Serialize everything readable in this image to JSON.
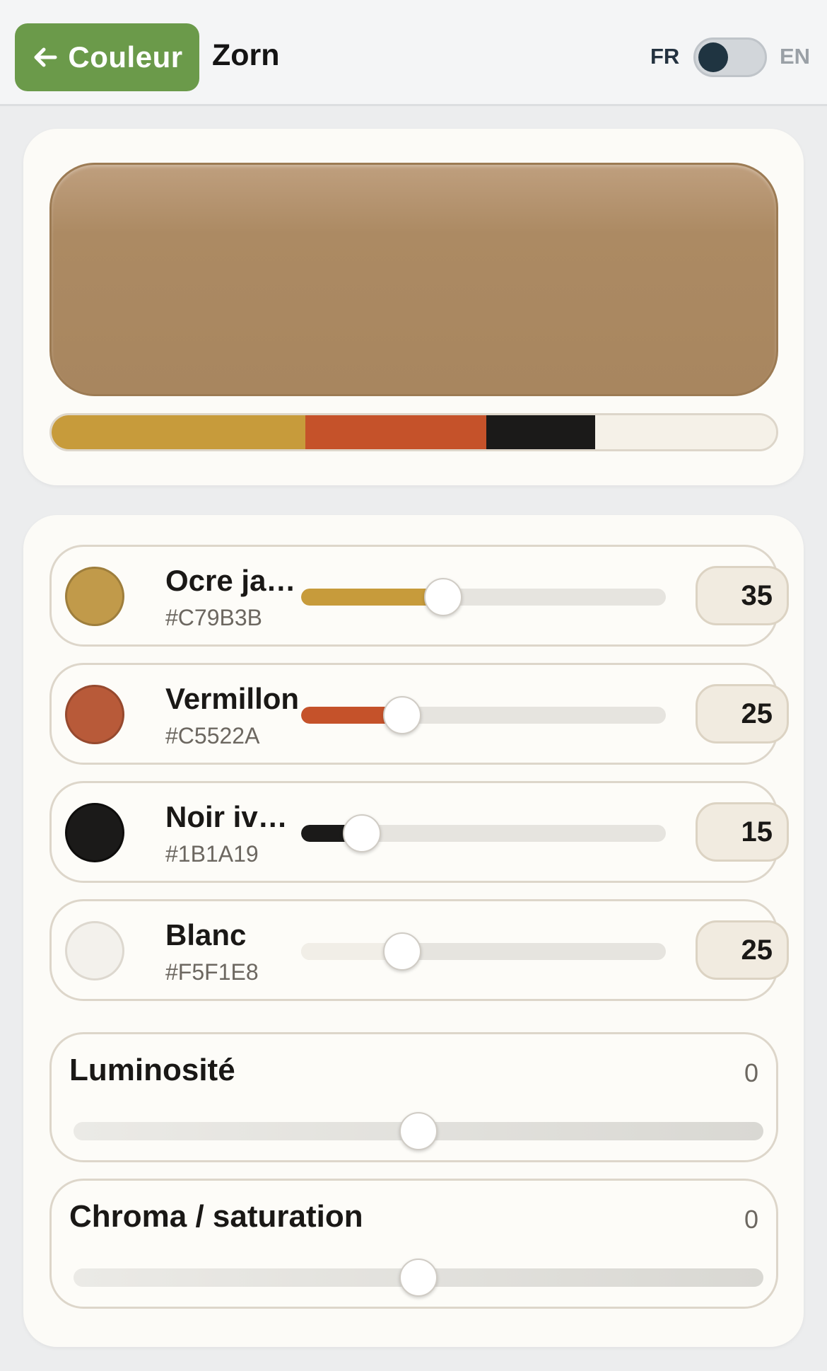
{
  "header": {
    "back_label": "Couleur",
    "back_icon": "arrow-left-icon",
    "title": "Zorn",
    "lang_left": "FR",
    "lang_right": "EN",
    "toggle_state": "FR"
  },
  "preview": {
    "mixed_color": "#A8865F",
    "mix_fractions": [
      0.35,
      0.25,
      0.15,
      0.25
    ]
  },
  "paints": [
    {
      "name": "Ocre ja…",
      "hex": "#C79B3B",
      "swatch": "#C19A4A",
      "value": "35",
      "level": 0.35
    },
    {
      "name": "Vermillon",
      "hex": "#C5522A",
      "swatch": "#B85A39",
      "value": "25",
      "level": 0.25
    },
    {
      "name": "Noir iv…",
      "hex": "#1B1A19",
      "swatch": "#1B1A19",
      "value": "15",
      "level": 0.15
    },
    {
      "name": "Blanc",
      "hex": "#F5F1E8",
      "swatch": "#F3F1EC",
      "value": "25",
      "level": 0.25
    }
  ],
  "adjustments": {
    "luminosity": {
      "label": "Luminosité",
      "value": "0",
      "level": 0.5
    },
    "chroma": {
      "label": "Chroma / saturation",
      "value": "0",
      "level": 0.5
    }
  }
}
